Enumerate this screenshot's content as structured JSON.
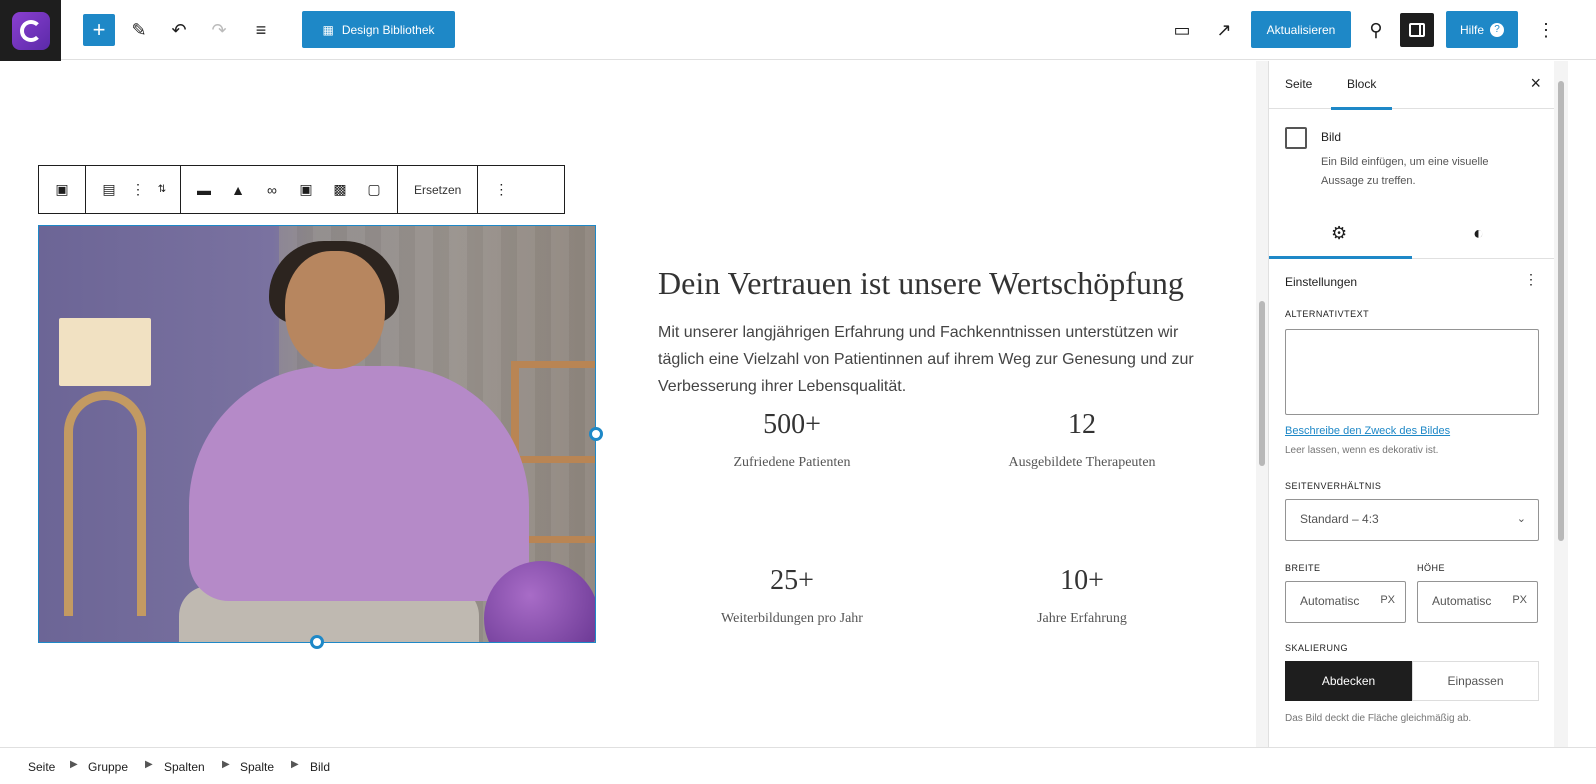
{
  "topbar": {
    "library_label": "Design Bibliothek",
    "update_label": "Aktualisieren",
    "help_label": "Hilfe"
  },
  "block_toolbar": {
    "replace_label": "Ersetzen"
  },
  "content": {
    "heading": "Dein Vertrauen ist unsere Wertschöpfung",
    "text": "Mit unserer langjährigen Erfahrung und Fachkenntnissen unterstützen wir täglich eine Vielzahl von Patientinnen auf ihrem Weg zur Genesung und zur Verbesserung ihrer Lebensqualität.",
    "stats": [
      {
        "value": "500+",
        "label": "Zufriedene Patienten"
      },
      {
        "value": "12",
        "label": "Ausgebildete Therapeuten"
      },
      {
        "value": "25+",
        "label": "Weiterbildungen pro Jahr"
      },
      {
        "value": "10+",
        "label": "Jahre Erfahrung"
      }
    ]
  },
  "sidebar": {
    "tabs": [
      "Seite",
      "Block"
    ],
    "block_name": "Bild",
    "block_description": "Ein Bild einfügen, um eine visuelle Aussage zu treffen.",
    "settings_title": "Einstellungen",
    "alt_label": "ALTERNATIVTEXT",
    "alt_link": "Beschreibe den Zweck des Bildes",
    "alt_hint": "Leer lassen, wenn es dekorativ ist.",
    "ratio_label": "SEITENVERHÄLTNIS",
    "ratio_value": "Standard – 4:3",
    "width_label": "BREITE",
    "height_label": "HÖHE",
    "width_value": "Automatisc",
    "height_value": "Automatisc",
    "unit": "PX",
    "scale_label": "SKALIERUNG",
    "scale_options": [
      "Abdecken",
      "Einpassen"
    ],
    "scale_hint": "Das Bild deckt die Fläche gleichmäßig ab."
  },
  "breadcrumbs": [
    "Seite",
    "Gruppe",
    "Spalten",
    "Spalte",
    "Bild"
  ]
}
